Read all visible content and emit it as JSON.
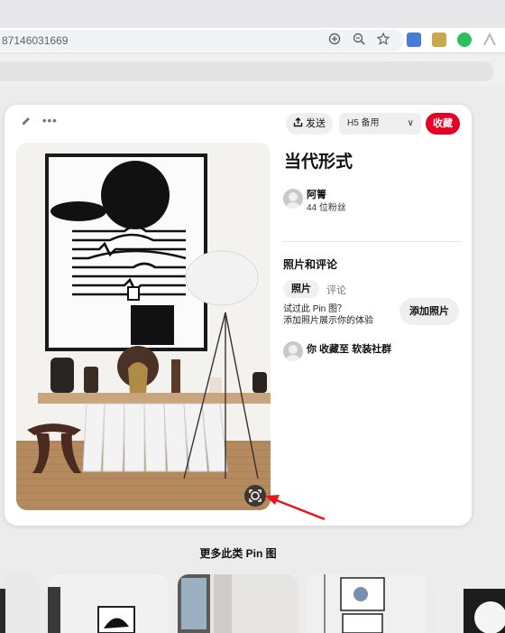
{
  "browser": {
    "url_fragment": "87146031669",
    "icons": [
      "zoom-in-icon",
      "magnify-icon",
      "star-icon"
    ],
    "extensions": [
      "translate-extension-icon",
      "image-extension-icon",
      "evernote-extension-icon",
      "extension-icon"
    ]
  },
  "pin": {
    "toolbar": {
      "edit_icon": "pencil-icon",
      "more_icon": "ellipsis-icon",
      "send_label": "发送",
      "board_value": "H5 备用",
      "save_label": "收藏"
    },
    "title": "当代形式",
    "author": {
      "name": "阿箐",
      "followers": "44 位粉丝"
    },
    "comments_section": {
      "heading": "照片和评论",
      "tab_photos": "照片",
      "tab_comments": "评论",
      "try_text": "试过此 Pin 图？",
      "share_text": "添加照片展示你的体验",
      "add_photo_label": "添加照片"
    },
    "saved_text": "你 收藏至 软装社群"
  },
  "more_pins": {
    "heading": "更多此类 Pin 图"
  },
  "colors": {
    "brand_red": "#e60023",
    "annotation_arrow": "#e8141b"
  }
}
